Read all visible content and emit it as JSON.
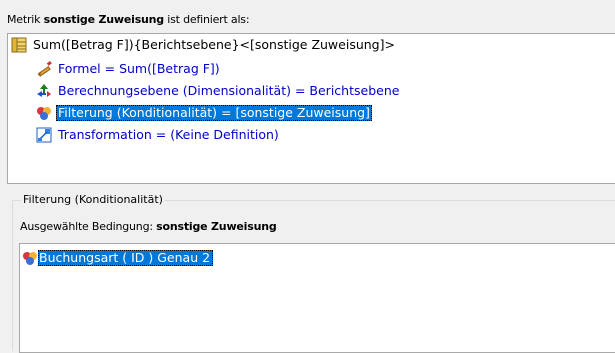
{
  "header": {
    "prefix": "Metrik",
    "metric_name": "sonstige Zuweisung",
    "suffix": "ist definiert als:"
  },
  "tree": {
    "root": {
      "label": "Sum([Betrag F]){Berichtsebene}<[sonstige Zuweisung]>",
      "icon": "metric-table-icon"
    },
    "children": [
      {
        "label": "Formel = Sum([Betrag F])",
        "icon": "formula-icon"
      },
      {
        "label": "Berechnungsebene (Dimensionalität) = Berichtsebene",
        "icon": "dimensionality-icon"
      },
      {
        "label": "Filterung (Konditionalität) = [sonstige Zuweisung]",
        "icon": "filter-icon",
        "selected": true
      },
      {
        "label": "Transformation = (Keine Definition)",
        "icon": "transformation-icon"
      }
    ]
  },
  "filter_section": {
    "group_title": "Filterung (Konditionalität)",
    "condition_prefix": "Ausgewählte Bedingung:",
    "condition_name": "sonstige Zuweisung",
    "items": [
      {
        "label": "Buchungsart ( ID )  Genau 2",
        "icon": "filter-condition-icon",
        "selected": true
      }
    ]
  },
  "colors": {
    "selection": "#0078d7",
    "link_text": "#0000cc",
    "panel_bg": "#ffffff",
    "window_bg": "#f0f0f0"
  }
}
